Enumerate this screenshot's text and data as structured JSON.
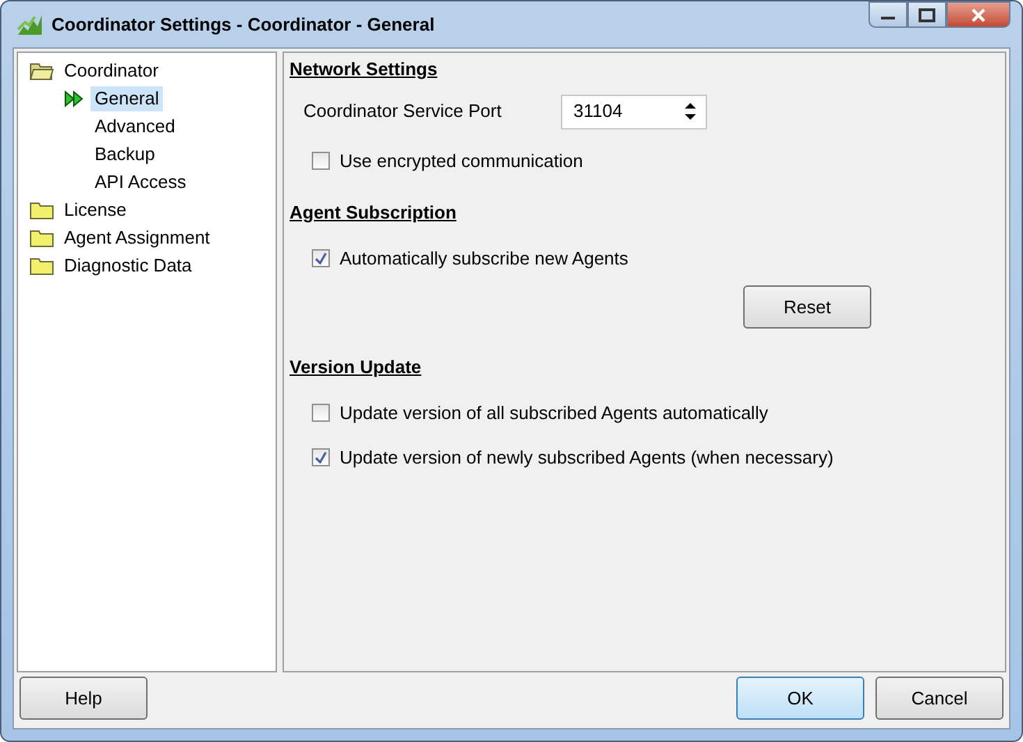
{
  "window": {
    "title": "Coordinator Settings - Coordinator - General"
  },
  "tree": [
    {
      "label": "Coordinator",
      "expanded": true,
      "selected": false,
      "children": [
        {
          "label": "General",
          "selected": true
        },
        {
          "label": "Advanced",
          "selected": false
        },
        {
          "label": "Backup",
          "selected": false
        },
        {
          "label": "API Access",
          "selected": false
        }
      ]
    },
    {
      "label": "License",
      "expanded": false,
      "selected": false
    },
    {
      "label": "Agent Assignment",
      "expanded": false,
      "selected": false
    },
    {
      "label": "Diagnostic Data",
      "expanded": false,
      "selected": false
    }
  ],
  "sections": [
    {
      "title": "Network Settings",
      "items": [
        {
          "kind": "spin",
          "label": "Coordinator Service Port",
          "value": "31104"
        },
        {
          "kind": "checkbox",
          "label": "Use encrypted communication",
          "checked": false
        }
      ]
    },
    {
      "title": "Agent Subscription",
      "items": [
        {
          "kind": "checkbox",
          "label": "Automatically subscribe new Agents",
          "checked": true
        },
        {
          "kind": "button",
          "label": "Reset"
        }
      ]
    },
    {
      "title": "Version Update",
      "items": [
        {
          "kind": "checkbox",
          "label": "Update version of all subscribed Agents automatically",
          "checked": false
        },
        {
          "kind": "checkbox",
          "label": "Update version of newly subscribed Agents (when necessary)",
          "checked": true
        }
      ]
    }
  ],
  "buttons": {
    "left": [
      "Help"
    ],
    "right": [
      {
        "label": "OK",
        "default": true
      },
      {
        "label": "Cancel",
        "default": false
      }
    ]
  }
}
